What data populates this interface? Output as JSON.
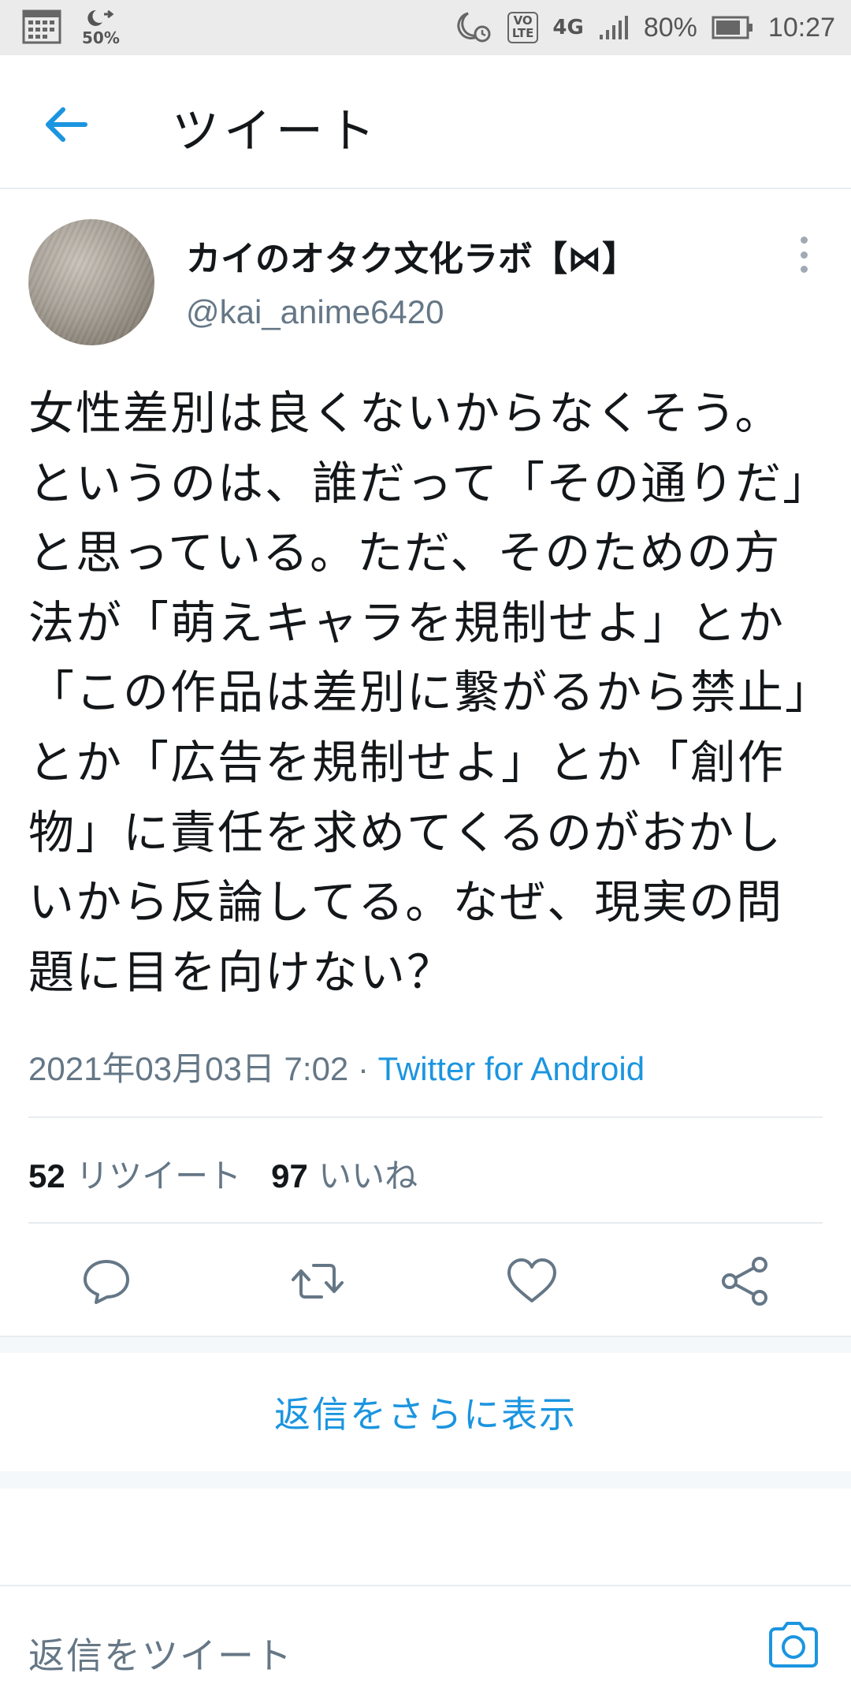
{
  "status_bar": {
    "dnd_percent": "50%",
    "volte_label": "VO LTE",
    "network": "4G",
    "battery": "80%",
    "time": "10:27",
    "icons": [
      "calendar-icon",
      "do-not-disturb-icon",
      "alarm-moon-icon",
      "volte-icon",
      "signal-icon",
      "battery-icon"
    ]
  },
  "header": {
    "title": "ツイート",
    "back_icon": "arrow-left-icon"
  },
  "tweet": {
    "display_name": "カイのオタク文化ラボ【⋈】",
    "handle": "@kai_anime6420",
    "text": "女性差別は良くないからなくそう。というのは、誰だって「その通りだ」と思っている。ただ、そのための方法が「萌えキャラを規制せよ」とか「この作品は差別に繋がるから禁止」とか「広告を規制せよ」とか「創作物」に責任を求めてくるのがおかしいから反論してる。なぜ、現実の問題に目を向けない？",
    "timestamp": "2021年03月03日 7:02",
    "separator": " · ",
    "source": "Twitter for Android",
    "retweet_count": "52",
    "retweet_label": "リツイート",
    "like_count": "97",
    "like_label": "いいね"
  },
  "actions": [
    "reply-icon",
    "retweet-icon",
    "like-icon",
    "share-icon"
  ],
  "more_replies_label": "返信をさらに表示",
  "reply_composer": {
    "placeholder": "返信をツイート",
    "camera_icon": "camera-icon"
  },
  "colors": {
    "accent": "#1b95e0",
    "text": "#14171a",
    "secondary": "#657786",
    "divider": "#e6ecf0",
    "status_bar_bg": "#ebebeb"
  }
}
